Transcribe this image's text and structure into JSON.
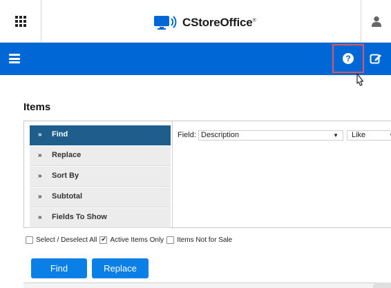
{
  "header": {
    "brand_name": "CStoreOffice",
    "brand_mark": "®",
    "icons": {
      "apps": "apps-grid-icon",
      "user": "user-icon",
      "logo": "monitor-logo-icon"
    }
  },
  "navbar": {
    "icons": {
      "menu": "hamburger-icon",
      "help": "help-icon",
      "edit": "edit-icon"
    },
    "help_glyph": "?",
    "accent_color": "#0067d6",
    "highlight_color": "#e0565f"
  },
  "page": {
    "title": "Items"
  },
  "menu": {
    "chevron": "»",
    "items": [
      {
        "label": "Find",
        "active": true
      },
      {
        "label": "Replace",
        "active": false
      },
      {
        "label": "Sort By",
        "active": false
      },
      {
        "label": "Subtotal",
        "active": false
      },
      {
        "label": "Fields To Show",
        "active": false
      }
    ]
  },
  "filter": {
    "field_label": "Field:",
    "field_value": "Description",
    "operator_value": "Like"
  },
  "options": [
    {
      "label": "Select / Deselect All",
      "checked": false
    },
    {
      "label": "Active Items Only",
      "checked": true
    },
    {
      "label": "Items Not for Sale",
      "checked": false
    }
  ],
  "buttons": {
    "find": "Find",
    "replace": "Replace",
    "color": "#0a7fe6"
  }
}
